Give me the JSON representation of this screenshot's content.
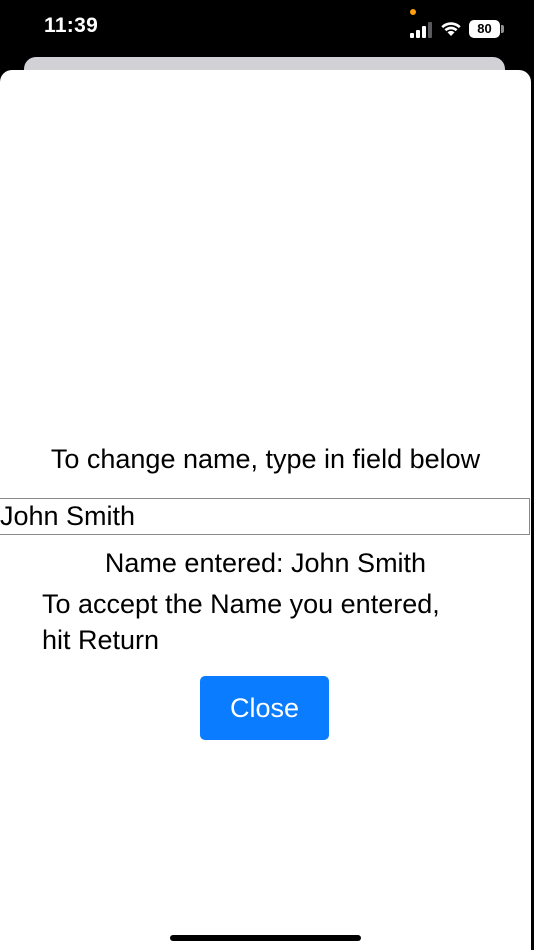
{
  "status_bar": {
    "time": "11:39",
    "battery": "80",
    "icons": [
      "signal-icon",
      "wifi-icon",
      "battery-icon"
    ],
    "privacy_dot_color": "#ff9f0a"
  },
  "sheet": {
    "instruction": "To change name, type in field below",
    "name_input": {
      "value": "John Smith",
      "placeholder": ""
    },
    "name_entered": "Name entered: John Smith",
    "accept_line1": "To accept the Name you entered,",
    "accept_line2": "hit Return",
    "close_label": "Close"
  },
  "colors": {
    "accent": "#0a7cff",
    "background": "#ffffff",
    "status_bar": "#000000"
  }
}
